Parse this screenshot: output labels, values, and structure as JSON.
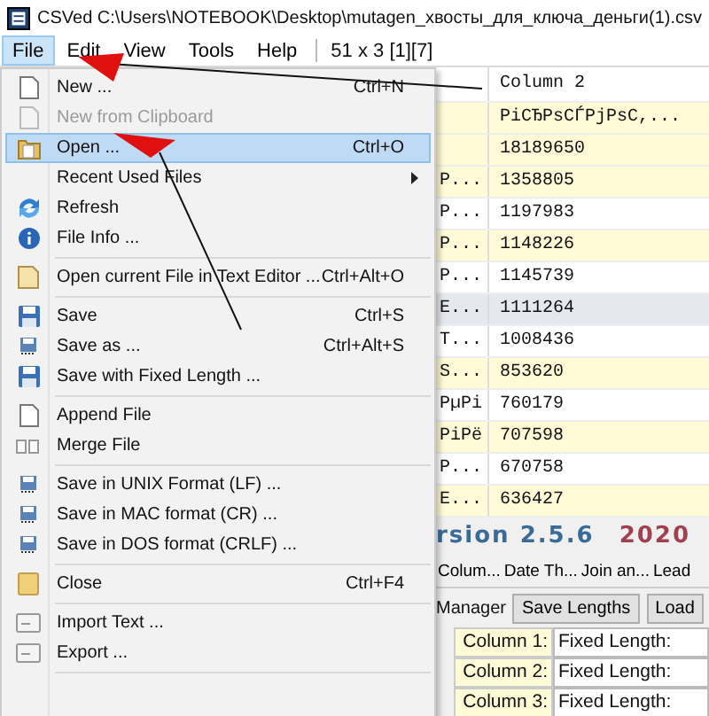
{
  "window": {
    "title": "CSVed C:\\Users\\NOTEBOOK\\Desktop\\mutagen_хвосты_для_ключа_деньги(1).csv"
  },
  "menubar": {
    "items": [
      {
        "label": "File",
        "selected": true
      },
      {
        "label": "Edit",
        "selected": false
      },
      {
        "label": "View",
        "selected": false
      },
      {
        "label": "Tools",
        "selected": false
      },
      {
        "label": "Help",
        "selected": false
      }
    ],
    "status": "51 x 3 [1][7]"
  },
  "file_menu": {
    "groups": [
      [
        {
          "label": "New ...",
          "shortcut": "Ctrl+N",
          "disabled": false,
          "selected": false
        },
        {
          "label": "New from Clipboard",
          "disabled": true,
          "selected": false
        },
        {
          "label": "Open ...",
          "shortcut": "Ctrl+O",
          "disabled": false,
          "selected": true
        },
        {
          "label": "Recent Used Files",
          "submenu": true,
          "disabled": false,
          "selected": false
        },
        {
          "label": "Refresh",
          "disabled": false,
          "selected": false
        },
        {
          "label": "File Info ...",
          "disabled": false,
          "selected": false
        }
      ],
      [
        {
          "label": "Open current File in Text Editor ...",
          "shortcut": "Ctrl+Alt+O",
          "disabled": false,
          "selected": false
        }
      ],
      [
        {
          "label": "Save",
          "shortcut": "Ctrl+S",
          "disabled": false,
          "selected": false
        },
        {
          "label": "Save as ...",
          "shortcut": "Ctrl+Alt+S",
          "disabled": false,
          "selected": false
        },
        {
          "label": "Save with Fixed Length ...",
          "disabled": false,
          "selected": false
        }
      ],
      [
        {
          "label": "Append File",
          "disabled": false,
          "selected": false
        },
        {
          "label": "Merge File",
          "disabled": false,
          "selected": false
        }
      ],
      [
        {
          "label": "Save in UNIX Format (LF) ...",
          "disabled": false,
          "selected": false
        },
        {
          "label": "Save in MAC format (CR) ...",
          "disabled": false,
          "selected": false
        },
        {
          "label": "Save in DOS format (CRLF) ...",
          "disabled": false,
          "selected": false
        }
      ],
      [
        {
          "label": "Close",
          "shortcut": "Ctrl+F4",
          "disabled": false,
          "selected": false
        }
      ],
      [
        {
          "label": "Import Text ...",
          "disabled": false,
          "selected": false
        },
        {
          "label": "Export ...",
          "disabled": false,
          "selected": false
        }
      ]
    ]
  },
  "grid": {
    "column_header": "Column 2",
    "rows": [
      {
        "column_2": "PiCЂPsCЃPjPsC,...",
        "selected": false
      },
      {
        "column_2": "18189650",
        "selected": false
      },
      {
        "column_1": "P...",
        "column_2": "1358805",
        "selected": false
      },
      {
        "column_1": "P...",
        "column_2": "1197983",
        "selected": false
      },
      {
        "column_1": "P...",
        "column_2": "1148226",
        "selected": false
      },
      {
        "column_1": "P...",
        "column_2": "1145739",
        "selected": false
      },
      {
        "column_1": "E...",
        "column_2": "1111264",
        "selected": true
      },
      {
        "column_1": "T...",
        "column_2": "1008436",
        "selected": false
      },
      {
        "column_1": "S...",
        "column_2": "853620",
        "selected": false
      },
      {
        "column_1": "PµPi",
        "column_2": "760179",
        "selected": false
      },
      {
        "column_1": "PiPё",
        "column_2": "707598",
        "selected": false
      },
      {
        "column_1": "P...",
        "column_2": "670758",
        "selected": false
      },
      {
        "column_1": "E...",
        "column_2": "636427",
        "selected": false
      }
    ]
  },
  "banner": {
    "version": "rsion 2.5.6",
    "year": "2020"
  },
  "tool_tabs": [
    "Colum...",
    "Date Th...",
    "Join an...",
    "Lead"
  ],
  "fixed_length": {
    "label": "Manager",
    "buttons": [
      "Save Lengths",
      "Load"
    ],
    "rows": [
      {
        "label": "Column 1:",
        "value": "Fixed Length:"
      },
      {
        "label": "Column 2:",
        "value": "Fixed Length:"
      },
      {
        "label": "Column 3:",
        "value": "Fixed Length:"
      }
    ]
  }
}
